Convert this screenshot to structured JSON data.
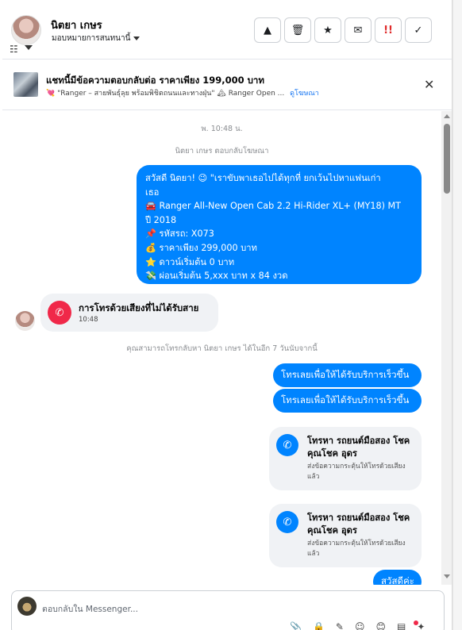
{
  "header": {
    "contact_name": "นิตยา เกษร",
    "assign_label": "มอบหมายการสนทนานี้",
    "actions": [
      {
        "icon": "warning-icon",
        "glyph": "▲"
      },
      {
        "icon": "trash-icon",
        "glyph": "🗑"
      },
      {
        "icon": "star-icon",
        "glyph": "★"
      },
      {
        "icon": "mail-icon",
        "glyph": "✉"
      },
      {
        "icon": "priority-icon",
        "glyph": "!!"
      },
      {
        "icon": "check-icon",
        "glyph": "✓"
      }
    ]
  },
  "banner": {
    "title": "แชทนี้มีข้อความตอบกลับต่อ ราคาเพียง 199,000 บาท",
    "subtitle": "💘 \"Ranger – สายพันธุ์ลุย พร้อมพิชิตถนนและทางฝุ่น\" 🏔 Ranger Open ...",
    "link": "ดูโฆษณา",
    "close_glyph": "✕"
  },
  "chat": {
    "timestamp": "พ. 10:48 น.",
    "ad_reply_note": "นิตยา เกษร ตอบกลับโฆษณา",
    "big_message": [
      "สวัสดี นิตยา! 😉 \"เราขับพาเธอไปได้ทุกที่ ยกเว้นไปหาแฟนเก่า",
      "เธอ",
      "🚘 Ranger All-New Open Cab 2.2 Hi-Rider XL+ (MY18) MT",
      "ปี 2018",
      "📌 รหัสรถ: X073",
      "💰 ราคาเพียง 299,000 บาท",
      "⭐ ดาวน์เริ่มต้น 0 บาท",
      "💸 ผ่อนเริ่มต้น 5,xxx บาท x 84 งวด"
    ],
    "missed_call": {
      "title": "การโทรด้วยเสียงที่ไม่ได้รับสาย",
      "time": "10:48",
      "icon_glyph": "✆"
    },
    "callback_note": "คุณสามารถโทรกลับหา นิตยา เกษร ได้ในอีก 7 วันนับจากนี้",
    "pills": [
      "โทรเลยเพื่อให้ได้รับบริการเร็วขึ้น",
      "โทรเลยเพื่อให้ได้รับบริการเร็วขึ้น"
    ],
    "cards": [
      {
        "title": "โทรหา รถยนต์มือสอง โชคคุณโชค อุดร",
        "sub": "ส่งข้อความกระตุ้นให้โทรด้วยเสียงแล้ว",
        "icon_glyph": "✆"
      },
      {
        "title": "โทรหา รถยนต์มือสอง โชคคุณโชค อุดร",
        "sub": "ส่งข้อความกระตุ้นให้โทรด้วยเสียงแล้ว",
        "icon_glyph": "✆"
      }
    ],
    "last_pill": "สวัสดีค่ะ"
  },
  "composer": {
    "placeholder": "ตอบกลับใน Messenger...",
    "tools": [
      "📎",
      "🔒",
      "✎",
      "☺",
      "😊",
      "▤",
      "✦"
    ]
  },
  "colors": {
    "accent": "#0084ff",
    "missed": "#f02849"
  }
}
